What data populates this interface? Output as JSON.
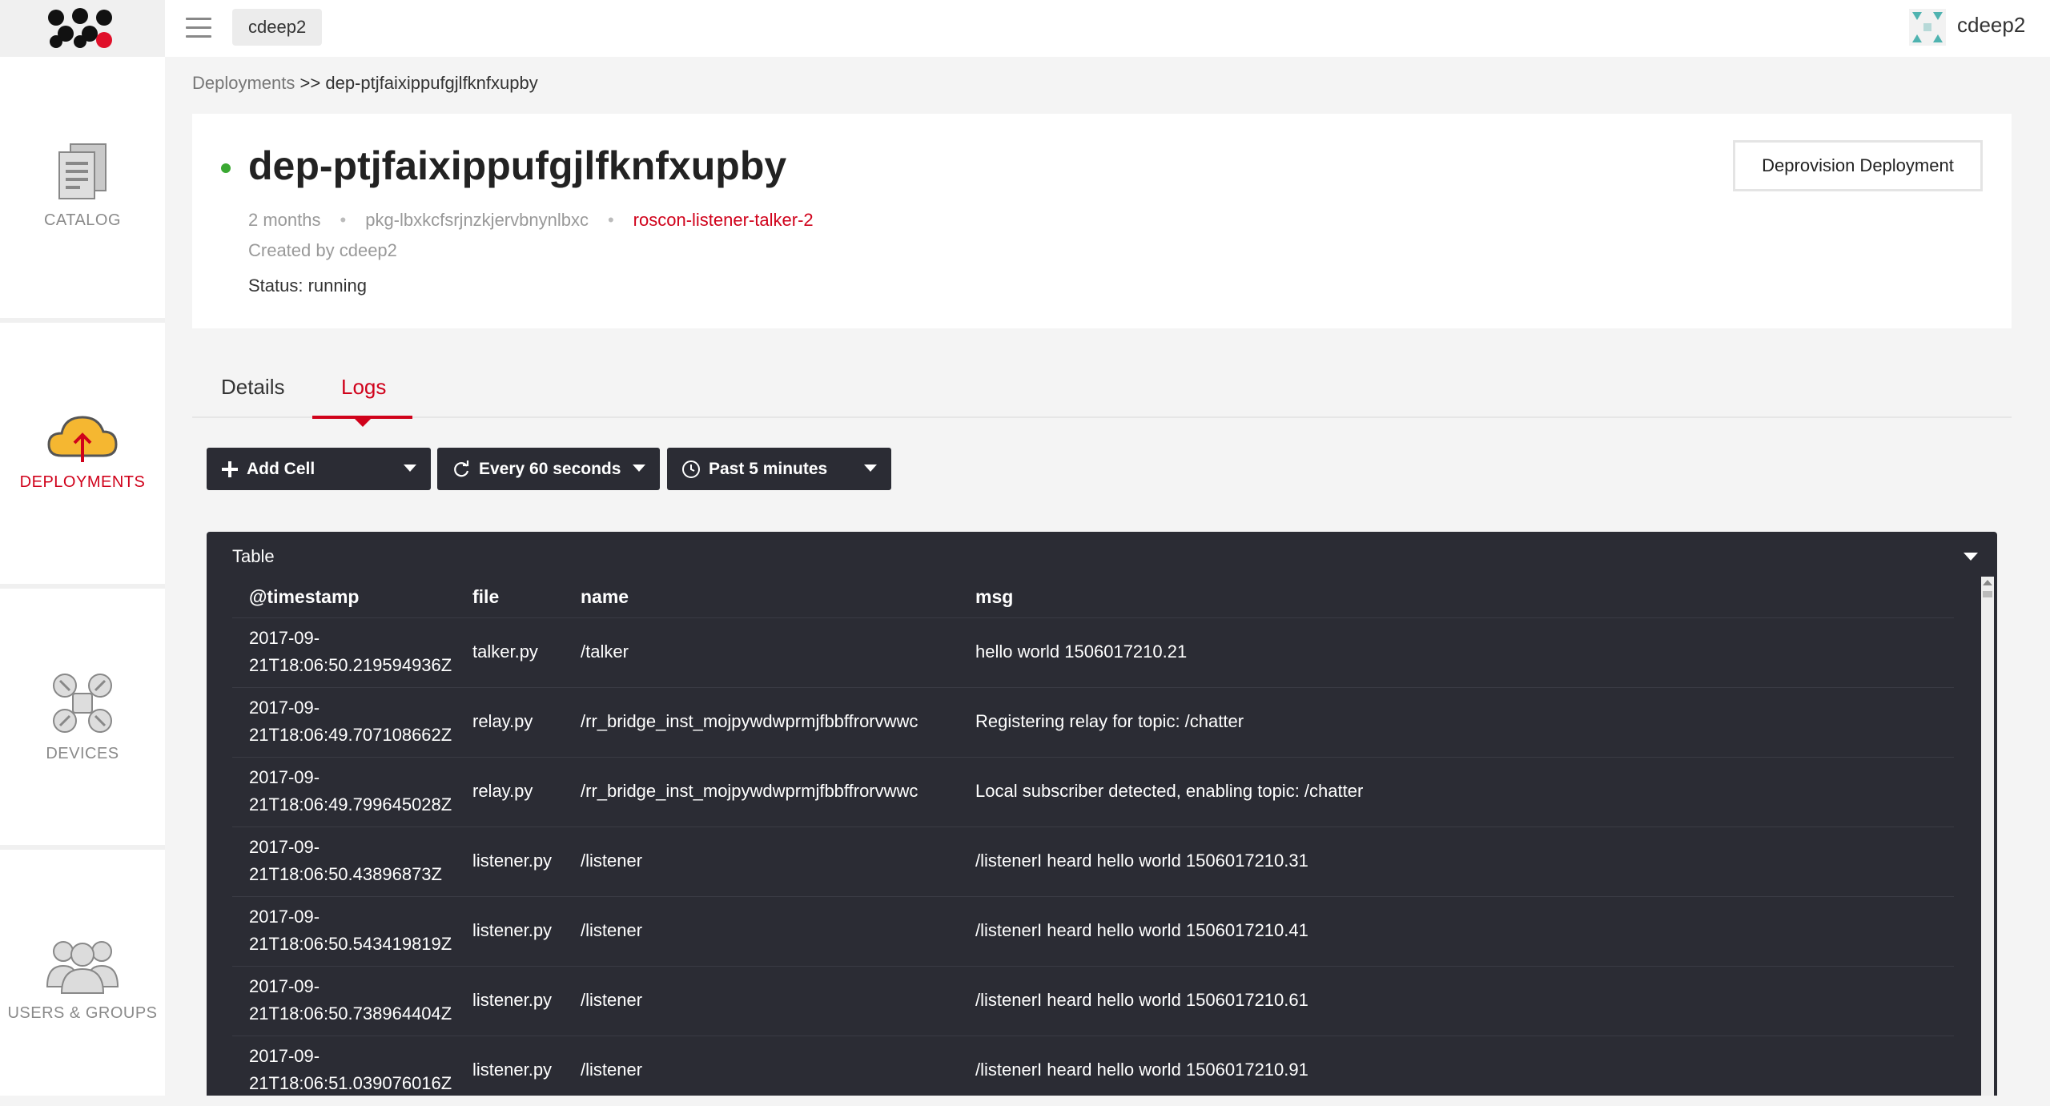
{
  "org": "cdeep2",
  "user": {
    "name": "cdeep2"
  },
  "nav": [
    {
      "label": "CATALOG",
      "icon": "catalog-icon"
    },
    {
      "label": "DEPLOYMENTS",
      "icon": "cloud-upload-icon"
    },
    {
      "label": "DEVICES",
      "icon": "devices-icon"
    },
    {
      "label": "USERS & GROUPS",
      "icon": "users-icon"
    }
  ],
  "breadcrumb": {
    "parent": "Deployments",
    "separator": ">>",
    "current": "dep-ptjfaixippufgjlfknfxupby"
  },
  "deployment": {
    "title": "dep-ptjfaixippufgjlfknfxupby",
    "age": "2 months",
    "package_id": "pkg-lbxkcfsrjnzkjervbnynlbxc",
    "package_name": "roscon-listener-talker-2",
    "created_by": "Created by cdeep2",
    "status": "Status: running",
    "deprovision_label": "Deprovision Deployment"
  },
  "tabs": [
    "Details",
    "Logs"
  ],
  "toolbar": {
    "add_cell": "Add Cell",
    "refresh": "Every 60 seconds",
    "range": "Past 5 minutes"
  },
  "table": {
    "title": "Table",
    "columns": [
      "@timestamp",
      "file",
      "name",
      "msg"
    ],
    "rows": [
      {
        "ts1": "2017-09-",
        "ts2": "21T18:06:50.219594936Z",
        "file": "talker.py",
        "name": "/talker",
        "msg": "hello world 1506017210.21"
      },
      {
        "ts1": "2017-09-",
        "ts2": "21T18:06:49.707108662Z",
        "file": "relay.py",
        "name": "/rr_bridge_inst_mojpywdwprmjfbbffrorvwwc",
        "msg": "Registering relay for topic: /chatter"
      },
      {
        "ts1": "2017-09-",
        "ts2": "21T18:06:49.799645028Z",
        "file": "relay.py",
        "name": "/rr_bridge_inst_mojpywdwprmjfbbffrorvwwc",
        "msg": "Local subscriber detected, enabling topic: /chatter"
      },
      {
        "ts1": "2017-09-",
        "ts2": "21T18:06:50.43896873Z",
        "file": "listener.py",
        "name": "/listener",
        "msg": "/listenerI heard hello world 1506017210.31"
      },
      {
        "ts1": "2017-09-",
        "ts2": "21T18:06:50.543419819Z",
        "file": "listener.py",
        "name": "/listener",
        "msg": "/listenerI heard hello world 1506017210.41"
      },
      {
        "ts1": "2017-09-",
        "ts2": "21T18:06:50.738964404Z",
        "file": "listener.py",
        "name": "/listener",
        "msg": "/listenerI heard hello world 1506017210.61"
      },
      {
        "ts1": "2017-09-",
        "ts2": "21T18:06:51.039076016Z",
        "file": "listener.py",
        "name": "/listener",
        "msg": "/listenerI heard hello world 1506017210.91"
      }
    ]
  },
  "colors": {
    "accent": "#d0021b",
    "status_running": "#3aa832",
    "panel_bg": "#2b2c34"
  }
}
